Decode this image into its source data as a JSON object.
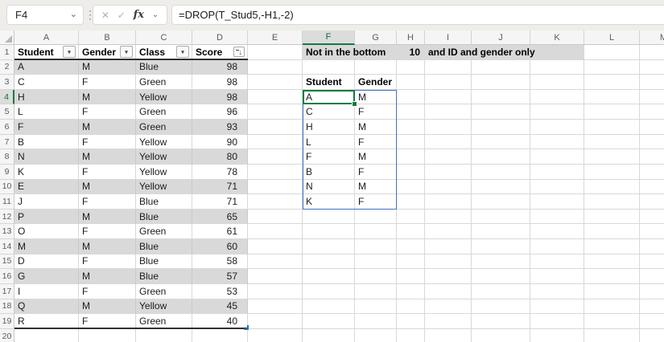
{
  "formula_bar": {
    "name_box": "F4",
    "fx_label": "fx",
    "formula": "=DROP(T_Stud5,-H1,-2)"
  },
  "icons": {
    "chevron_down": "⌄",
    "separator_dots": "⋮",
    "cancel": "✕",
    "confirm": "✓",
    "filter_dropdown": "▾",
    "sort_descending": "↓"
  },
  "sheet": {
    "columns": [
      "A",
      "B",
      "C",
      "D",
      "E",
      "F",
      "G",
      "H",
      "I",
      "J",
      "K",
      "L",
      "M"
    ],
    "row_numbers": [
      "1",
      "2",
      "3",
      "4",
      "5",
      "6",
      "7",
      "8",
      "9",
      "10",
      "11",
      "12",
      "13",
      "14",
      "15",
      "16",
      "17",
      "18",
      "19",
      "20"
    ],
    "selected_column": "F",
    "selected_row": "4",
    "active_cell": "F4"
  },
  "source_table": {
    "headers": [
      "Student",
      "Gender",
      "Class",
      "Score"
    ],
    "header_icons": [
      "filter-dropdown",
      "filter-dropdown",
      "filter-dropdown",
      "sort-descending-filter"
    ],
    "rows": [
      [
        "A",
        "M",
        "Blue",
        "98"
      ],
      [
        "C",
        "F",
        "Green",
        "98"
      ],
      [
        "H",
        "M",
        "Yellow",
        "98"
      ],
      [
        "L",
        "F",
        "Green",
        "96"
      ],
      [
        "F",
        "M",
        "Green",
        "93"
      ],
      [
        "B",
        "F",
        "Yellow",
        "90"
      ],
      [
        "N",
        "M",
        "Yellow",
        "80"
      ],
      [
        "K",
        "F",
        "Yellow",
        "78"
      ],
      [
        "E",
        "M",
        "Yellow",
        "71"
      ],
      [
        "J",
        "F",
        "Blue",
        "71"
      ],
      [
        "P",
        "M",
        "Blue",
        "65"
      ],
      [
        "O",
        "F",
        "Green",
        "61"
      ],
      [
        "M",
        "M",
        "Blue",
        "60"
      ],
      [
        "D",
        "F",
        "Blue",
        "58"
      ],
      [
        "G",
        "M",
        "Blue",
        "57"
      ],
      [
        "I",
        "F",
        "Green",
        "53"
      ],
      [
        "Q",
        "M",
        "Yellow",
        "45"
      ],
      [
        "R",
        "F",
        "Green",
        "40"
      ]
    ]
  },
  "note_row": {
    "label": "Not in the bottom",
    "value": "10",
    "suffix": "and ID and gender only"
  },
  "result_table": {
    "headers": [
      "Student",
      "Gender"
    ],
    "rows": [
      [
        "A",
        "M"
      ],
      [
        "C",
        "F"
      ],
      [
        "H",
        "M"
      ],
      [
        "L",
        "F"
      ],
      [
        "F",
        "M"
      ],
      [
        "B",
        "F"
      ],
      [
        "N",
        "M"
      ],
      [
        "K",
        "F"
      ]
    ]
  },
  "colors": {
    "excel_green": "#107C41",
    "spill_blue": "#4472C4",
    "band_gray": "#D9D9D9",
    "note_fill": "#D9D9D9"
  }
}
